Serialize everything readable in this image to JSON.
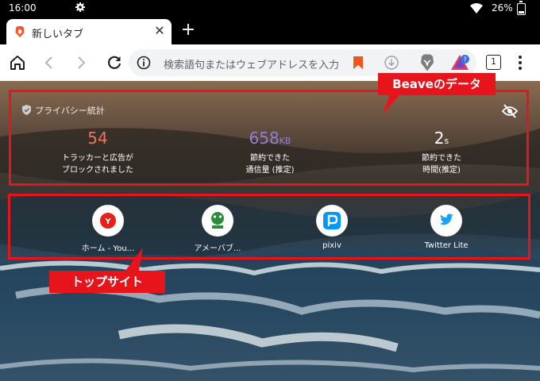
{
  "status_bar": {
    "time": "16:00",
    "battery": "26%"
  },
  "tab": {
    "title": "新しいタブ"
  },
  "toolbar": {
    "search_placeholder": "検索語句またはウェブアドレスを入力",
    "tab_count": "1"
  },
  "privacy": {
    "heading": "プライバシー統計",
    "stats": [
      {
        "value": "54",
        "unit": "",
        "desc_line1": "トラッカーと広告が",
        "desc_line2": "ブロックされました",
        "color": "#e8775c"
      },
      {
        "value": "658",
        "unit": "KB",
        "desc_line1": "節約できた",
        "desc_line2": "通信量 (推定)",
        "color": "#8f7fd6"
      },
      {
        "value": "2",
        "unit": "s",
        "desc_line1": "節約できた",
        "desc_line2": "時間(推定)",
        "color": "#ffffff"
      }
    ]
  },
  "top_sites": [
    {
      "name": "ホーム - You...",
      "icon": "youtube-y-icon"
    },
    {
      "name": "アメーバブ...",
      "icon": "ameba-icon"
    },
    {
      "name": "pixiv",
      "icon": "pixiv-icon"
    },
    {
      "name": "Twitter Lite",
      "icon": "twitter-icon"
    }
  ],
  "annotations": {
    "stats_callout": "Beaveのデータ",
    "sites_callout": "トップサイト"
  },
  "colors": {
    "highlight_red": "#e8141c",
    "brave_orange": "#fb542b"
  }
}
